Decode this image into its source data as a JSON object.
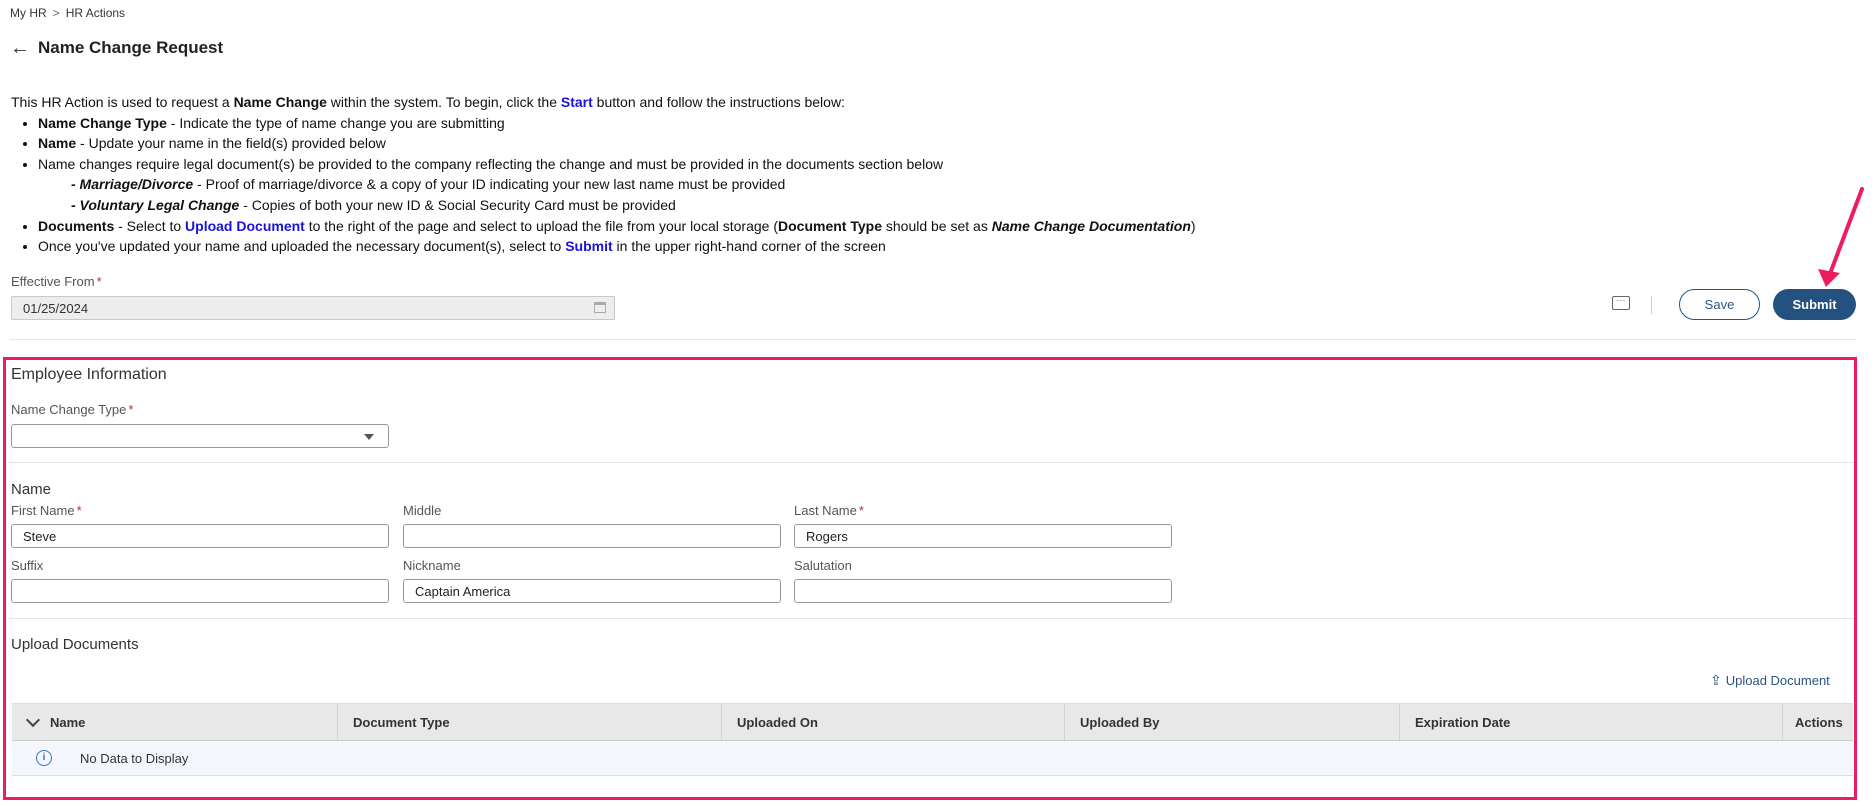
{
  "breadcrumb": {
    "home": "My HR",
    "separator": ">",
    "current": "HR Actions"
  },
  "page": {
    "title": "Name Change Request",
    "back_icon": "arrow-left-icon"
  },
  "instructions": {
    "intro_pre": "This HR Action is used to request a ",
    "intro_bold": "Name Change",
    "intro_mid": " within the system. To begin, click the ",
    "intro_link": "Start",
    "intro_post": " button and follow the instructions below:",
    "b1_bold": "Name Change Type",
    "b1_text": " - Indicate the type of name change you are submitting",
    "b2_bold": "Name",
    "b2_text": " - Update your name in the field(s) provided below",
    "b3_text": "Name changes require legal document(s) be provided to the company reflecting the change and must be provided in the documents section below",
    "s1_bold": "- Marriage/Divorce",
    "s1_text": " - Proof of marriage/divorce & a copy of your ID indicating your new last name must be provided",
    "s2_bold": "- Voluntary Legal Change",
    "s2_text": " - Copies of both your new ID & Social Security Card must be provided",
    "b4_bold": "Documents",
    "b4_a": " - Select to ",
    "b4_link": "Upload Document",
    "b4_b": " to the right of the page and select to upload the file from your local storage (",
    "b4_bold2": "Document Type",
    "b4_c": " should be set as ",
    "b4_bold3": "Name Change Documentation",
    "b4_d": ")",
    "b5_a": "Once you've updated your name and uploaded the necessary document(s), select to ",
    "b5_link": "Submit",
    "b5_b": " in the upper right-hand corner of the screen"
  },
  "effective": {
    "label": "Effective From",
    "required": "*",
    "value": "01/25/2024"
  },
  "actions": {
    "save_label": "Save",
    "submit_label": "Submit"
  },
  "employee_info": {
    "title": "Employee Information",
    "name_change_type_label": "Name Change Type",
    "name_change_type_value": ""
  },
  "name": {
    "title": "Name",
    "first_label": "First Name",
    "first_value": "Steve",
    "middle_label": "Middle",
    "middle_value": "",
    "last_label": "Last Name",
    "last_value": "Rogers",
    "suffix_label": "Suffix",
    "suffix_value": "",
    "nickname_label": "Nickname",
    "nickname_value": "Captain America",
    "salutation_label": "Salutation",
    "salutation_value": ""
  },
  "uploads": {
    "title": "Upload Documents",
    "upload_link": "Upload Document",
    "columns": [
      "Name",
      "Document Type",
      "Uploaded On",
      "Uploaded By",
      "Expiration Date",
      "Actions"
    ],
    "empty_text": "No Data to Display"
  },
  "colors": {
    "accent": "#24527e",
    "highlight": "#ef1c5d",
    "link": "#1a12d8"
  }
}
